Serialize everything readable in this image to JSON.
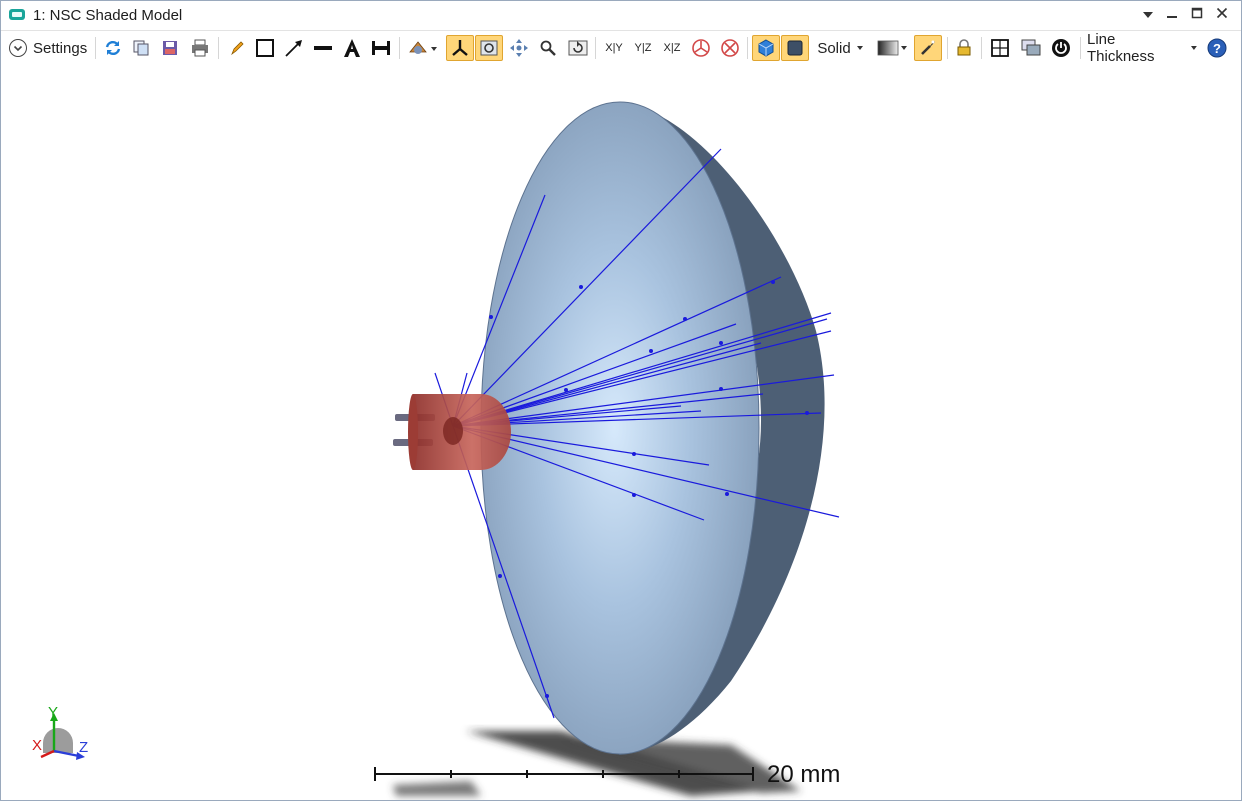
{
  "window": {
    "title": "1: NSC Shaded Model"
  },
  "toolbar": {
    "settings_label": "Settings",
    "render_mode_label": "Solid",
    "line_thickness_label": "Line Thickness",
    "view_xy": "X|Y",
    "view_yz": "Y|Z",
    "view_xz": "X|Z"
  },
  "viewport": {
    "scale_bar_label": "20 mm",
    "axes": {
      "x_label": "X",
      "y_label": "Y",
      "z_label": "Z"
    }
  },
  "colors": {
    "ray": "#1a1adc",
    "reflector": "#8fa8c4",
    "led_body": "#b5524a",
    "active_tool": "#ffd679"
  },
  "icons": [
    "settings-chevron-icon",
    "refresh-icon",
    "copy-icon",
    "save-icon",
    "print-icon",
    "pencil-icon",
    "rectangle-icon",
    "arrow-icon",
    "line-icon",
    "text-icon",
    "dimension-icon",
    "camera-icon",
    "axes-icon",
    "fit-icon",
    "pan-icon",
    "zoom-icon",
    "reset-view-icon",
    "fan-icon",
    "no-fan-icon",
    "shade-icon",
    "solid-icon",
    "gradient-icon",
    "light-icon",
    "lock-icon",
    "layout-icon",
    "window-icon",
    "power-icon",
    "help-icon"
  ]
}
